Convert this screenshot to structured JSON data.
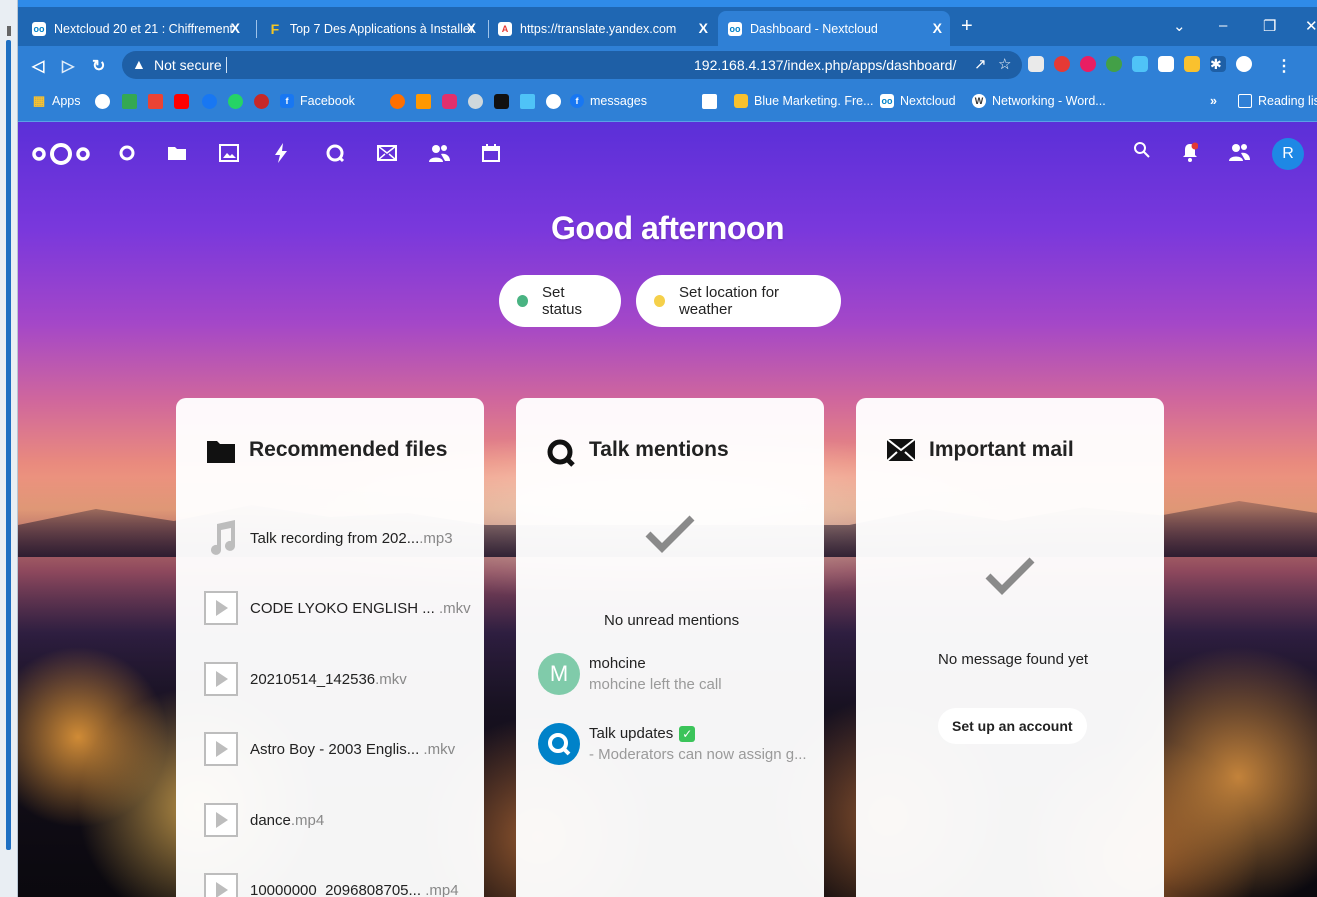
{
  "browser": {
    "tabs": [
      {
        "title": "Nextcloud 20 et 21 : Chiffrement",
        "close": "X"
      },
      {
        "title": "Top 7 Des Applications à Installer",
        "close": "X"
      },
      {
        "title": "https://translate.yandex.com",
        "close": "X"
      },
      {
        "title": "Dashboard - Nextcloud",
        "close": "X",
        "active": true
      }
    ],
    "new_tab": "+",
    "url_warning": "Not secure",
    "url": "192.168.4.137/index.php/apps/dashboard/",
    "bookmarks": {
      "apps": "Apps",
      "facebook": "Facebook",
      "messages": "messages",
      "blue_marketing": "Blue Marketing. Fre...",
      "nextcloud": "Nextcloud",
      "networking": "Networking - Word...",
      "overflow": "»",
      "reading_list": "Reading lis"
    }
  },
  "dashboard": {
    "greeting": "Good afternoon",
    "set_status": "Set status",
    "set_weather": "Set location for weather",
    "user_initial": "R"
  },
  "recommended_files": {
    "title": "Recommended files",
    "files": [
      {
        "name": "Talk recording from 202...",
        "ext": ".mp3",
        "icon": "music-note-icon"
      },
      {
        "name": "CODE LYOKO ENGLISH ... ",
        "ext": ".mkv",
        "icon": "video-file-icon"
      },
      {
        "name": "20210514_142536",
        "ext": ".mkv",
        "icon": "video-file-icon"
      },
      {
        "name": "Astro Boy - 2003 Englis... ",
        "ext": ".mkv",
        "icon": "video-file-icon"
      },
      {
        "name": "dance",
        "ext": ".mp4",
        "icon": "video-file-icon"
      },
      {
        "name": "10000000_2096808705... ",
        "ext": ".mp4",
        "icon": "video-file-icon"
      }
    ]
  },
  "talk_mentions": {
    "title": "Talk mentions",
    "empty": "No unread mentions",
    "items": [
      {
        "avatar": "M",
        "name": "mohcine",
        "sub": "mohcine left the call"
      },
      {
        "avatar": "",
        "name": "Talk updates",
        "sub": "- Moderators can now assign g..."
      }
    ]
  },
  "important_mail": {
    "title": "Important mail",
    "empty": "No message found yet",
    "setup": "Set up an account"
  },
  "colors": {
    "tab_bar": "#1f67b3",
    "chrome": "#2f80d6",
    "avatar": "#1e88e5",
    "online": "#49b382",
    "talk_blue": "#0082c9"
  }
}
